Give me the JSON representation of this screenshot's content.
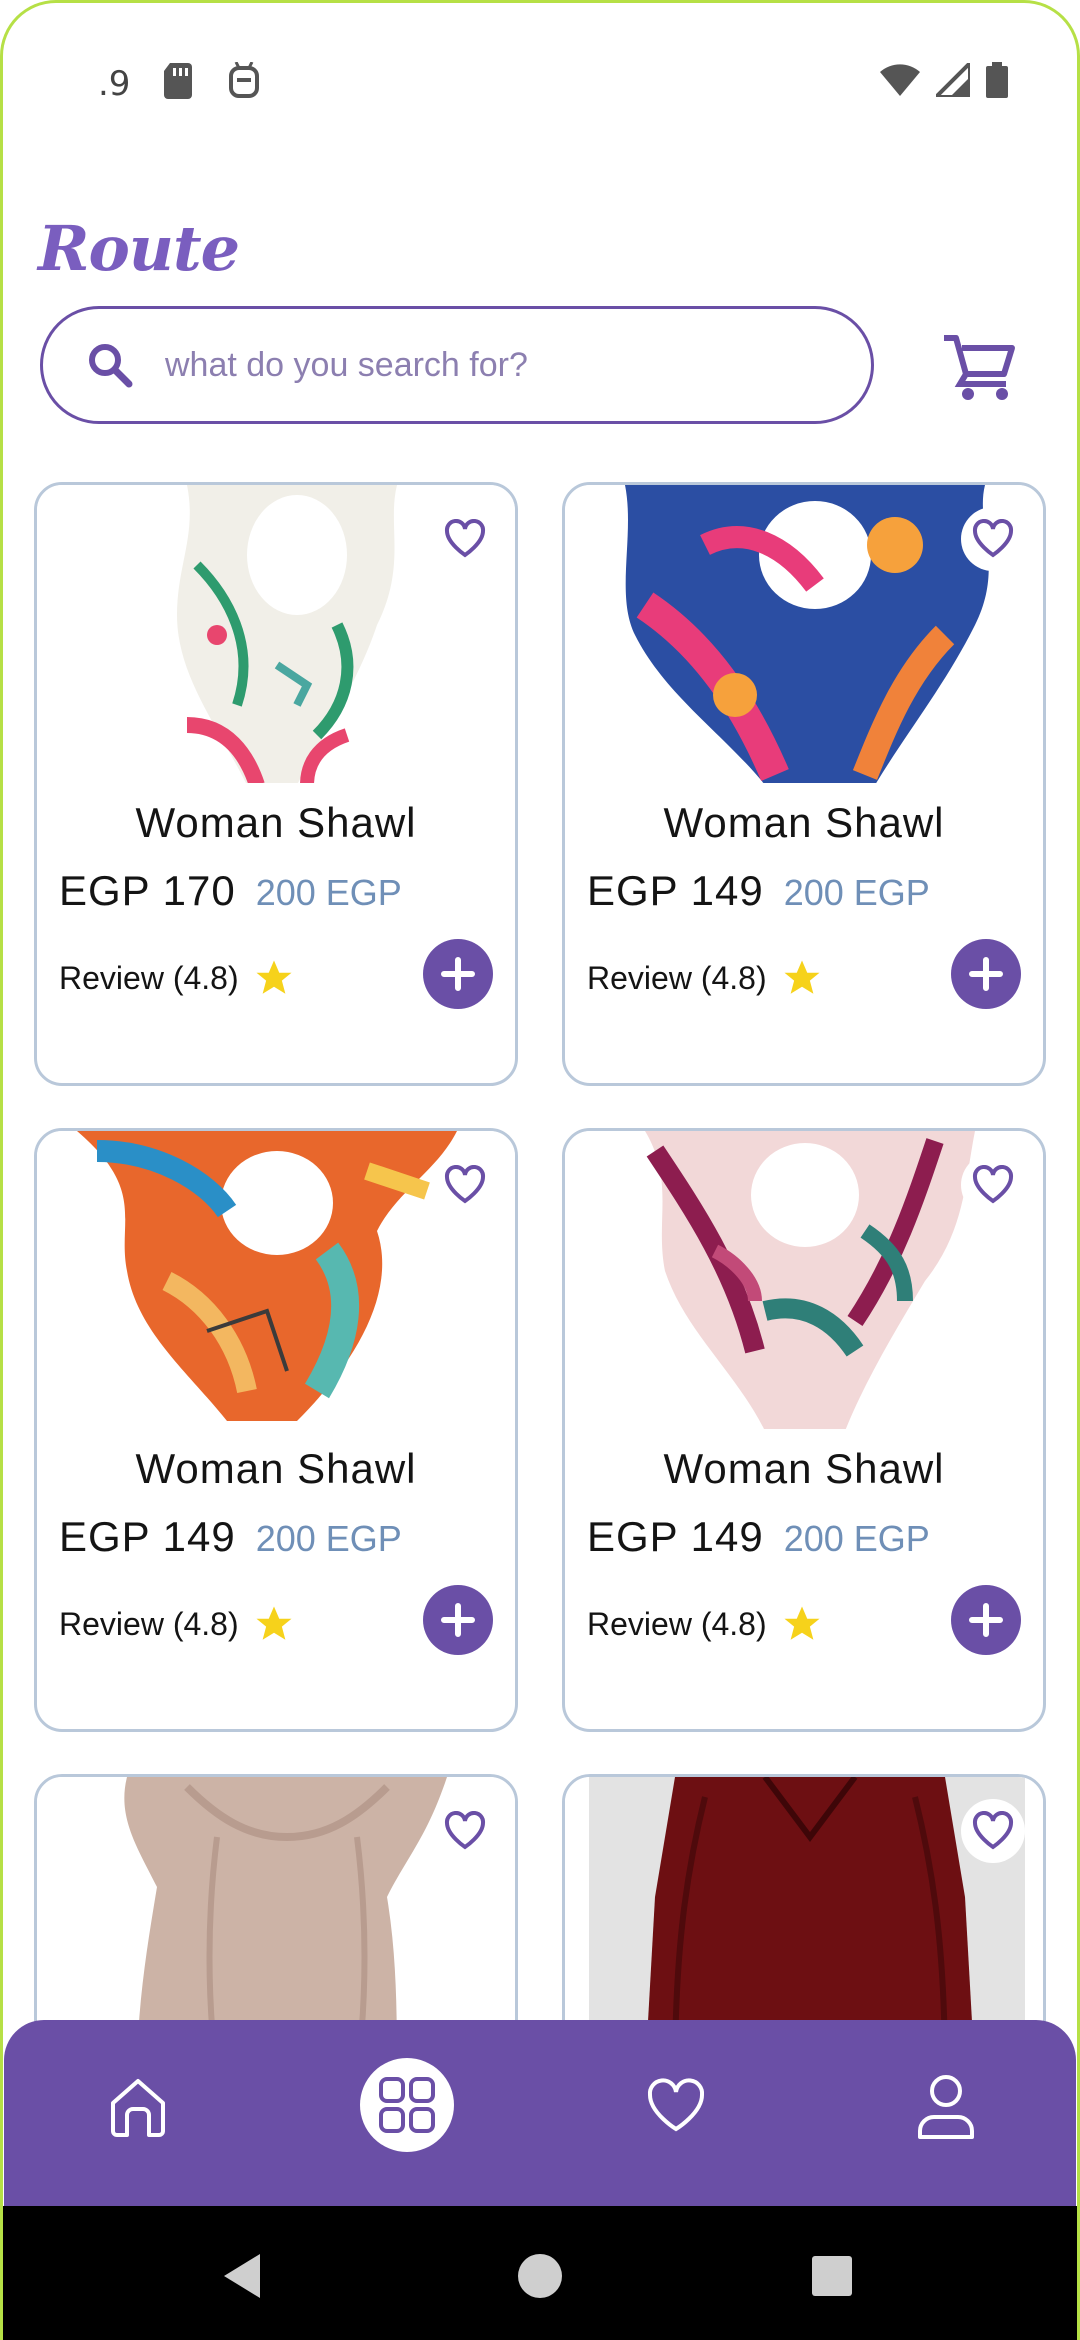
{
  "status_bar": {
    "time": ".9",
    "icons": [
      "sd-card-icon",
      "android-debug-icon",
      "wifi-icon",
      "signal-icon",
      "battery-icon"
    ]
  },
  "header": {
    "logo_text": "Route",
    "search_placeholder": "what do you search for?",
    "cart_icon": "cart-icon"
  },
  "colors": {
    "brand": "#6a4fa6",
    "card_border": "#b9c8da",
    "old_price": "#6f8fb7",
    "star": "#f6d21b"
  },
  "products": [
    {
      "name": "Woman Shawl",
      "price": "EGP 170",
      "old_price": "200 EGP",
      "review": "Review (4.8)"
    },
    {
      "name": "Woman Shawl",
      "price": "EGP 149",
      "old_price": "200 EGP",
      "review": "Review (4.8)"
    },
    {
      "name": "Woman Shawl",
      "price": "EGP 149",
      "old_price": "200 EGP",
      "review": "Review (4.8)"
    },
    {
      "name": "Woman Shawl",
      "price": "EGP 149",
      "old_price": "200 EGP",
      "review": "Review (4.8)"
    },
    {
      "name": "",
      "price": "",
      "old_price": "",
      "review": ""
    },
    {
      "name": "",
      "price": "",
      "old_price": "",
      "review": ""
    }
  ],
  "bottom_nav": {
    "items": [
      "home-icon",
      "categories-icon",
      "favorites-icon",
      "profile-icon"
    ],
    "active": "categories-icon"
  }
}
